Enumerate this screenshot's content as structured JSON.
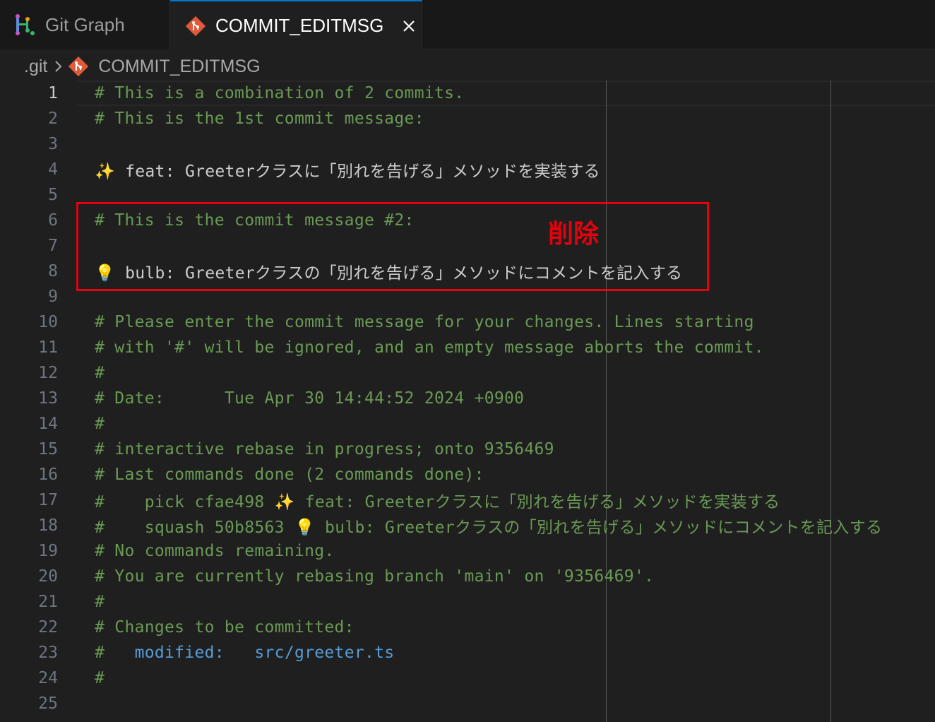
{
  "tabs": [
    {
      "label": "Git Graph",
      "icon": "git-graph-icon",
      "active": false
    },
    {
      "label": "COMMIT_EDITMSG",
      "icon": "git-file-icon",
      "active": true,
      "close": "close-icon"
    }
  ],
  "breadcrumb": {
    "folder": ".git",
    "file": "COMMIT_EDITMSG"
  },
  "editor": {
    "current_line": "1",
    "lines": [
      {
        "n": "1",
        "text": "# This is a combination of 2 commits."
      },
      {
        "n": "2",
        "text": "# This is the 1st commit message:"
      },
      {
        "n": "3",
        "text": ""
      },
      {
        "n": "4",
        "text": "✨ feat: Greeterクラスに「別れを告げる」メソッドを実装する"
      },
      {
        "n": "5",
        "text": ""
      },
      {
        "n": "6",
        "text": "# This is the commit message #2:"
      },
      {
        "n": "7",
        "text": ""
      },
      {
        "n": "8",
        "text": "💡 bulb: Greeterクラスの「別れを告げる」メソッドにコメントを記入する"
      },
      {
        "n": "9",
        "text": ""
      },
      {
        "n": "10",
        "text": "# Please enter the commit message for your changes. Lines starting"
      },
      {
        "n": "11",
        "text": "# with '#' will be ignored, and an empty message aborts the commit."
      },
      {
        "n": "12",
        "text": "#"
      },
      {
        "n": "13",
        "text": "# Date:      Tue Apr 30 14:44:52 2024 +0900"
      },
      {
        "n": "14",
        "text": "#"
      },
      {
        "n": "15",
        "text": "# interactive rebase in progress; onto 9356469"
      },
      {
        "n": "16",
        "text": "# Last commands done (2 commands done):"
      },
      {
        "n": "17",
        "text": "#    pick cfae498 ✨ feat: Greeterクラスに「別れを告げる」メソッドを実装する"
      },
      {
        "n": "18",
        "text": "#    squash 50b8563 💡 bulb: Greeterクラスの「別れを告げる」メソッドにコメントを記入する"
      },
      {
        "n": "19",
        "text": "# No commands remaining."
      },
      {
        "n": "20",
        "text": "# You are currently rebasing branch 'main' on '9356469'."
      },
      {
        "n": "21",
        "text": "#"
      },
      {
        "n": "22",
        "text": "# Changes to be committed:"
      },
      {
        "n": "23",
        "hash": "#   ",
        "keyword": "modified:",
        "gap": "   ",
        "path": "src/greeter.ts"
      },
      {
        "n": "24",
        "text": "#"
      },
      {
        "n": "25",
        "text": ""
      }
    ]
  },
  "annotation": {
    "label": "削除",
    "color": "#e6000c"
  },
  "colors": {
    "comment": "#6a9955",
    "keyword": "#569cd6",
    "accent": "#0078d4",
    "background": "#1f1f1f"
  }
}
